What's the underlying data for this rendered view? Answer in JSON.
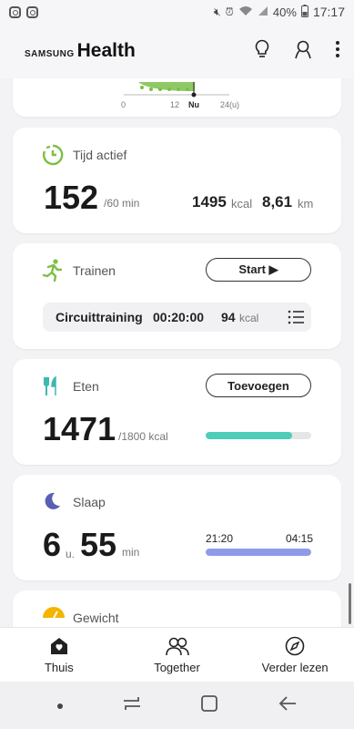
{
  "status": {
    "battery": "40%",
    "time": "17:17"
  },
  "app": {
    "brand_small": "SAMSUNG",
    "brand_large": "Health"
  },
  "step_chart": {
    "ticks": [
      "0",
      "12",
      "Nu",
      "24(u)"
    ]
  },
  "active": {
    "title": "Tijd actief",
    "value": "152",
    "goal": "/60 min",
    "kcal_value": "1495",
    "kcal_unit": "kcal",
    "km_value": "8,61",
    "km_unit": "km"
  },
  "exercise": {
    "title": "Trainen",
    "start_label": "Start ▶",
    "workout_name": "Circuittraining",
    "duration": "00:20:00",
    "kcal_value": "94",
    "kcal_unit": "kcal"
  },
  "food": {
    "title": "Eten",
    "add_label": "Toevoegen",
    "value": "1471",
    "goal": "/1800 kcal",
    "progress": 0.817,
    "bar_color": "#4fcdb9"
  },
  "sleep": {
    "title": "Slaap",
    "hours": "6",
    "hours_unit": "u.",
    "minutes": "55",
    "minutes_unit": "min",
    "start": "21:20",
    "end": "04:15",
    "bar_color": "#8f9be8"
  },
  "weight": {
    "title": "Gewicht"
  },
  "nav": {
    "home": "Thuis",
    "together": "Together",
    "discover": "Verder lezen"
  },
  "colors": {
    "accent_green": "#7bc043"
  }
}
